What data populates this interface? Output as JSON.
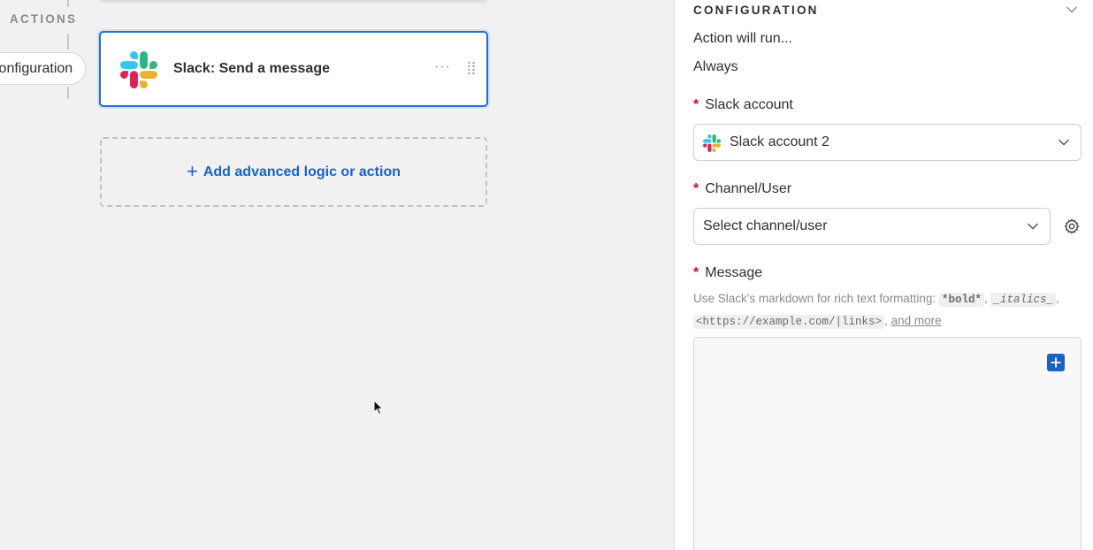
{
  "canvas": {
    "section_label": "ACTIONS",
    "config_pill_label": "Configuration",
    "action_card": {
      "title": "Slack: Send a message",
      "menu_glyph": "···"
    },
    "add_action_label": "Add advanced logic or action"
  },
  "panel": {
    "section_title": "CONFIGURATION",
    "run_label": "Action will run...",
    "run_value": "Always",
    "slack_account": {
      "label": "Slack account",
      "value": "Slack account 2"
    },
    "channel": {
      "label": "Channel/User",
      "value": "Select channel/user"
    },
    "message": {
      "label": "Message",
      "help_prefix": "Use Slack's markdown for rich text formatting:",
      "code_bold": "*bold*",
      "code_italic": "_italics_",
      "code_link": "<https://example.com/|links>",
      "more_link": "and more"
    },
    "required_mark": "*"
  },
  "colors": {
    "accent": "#1f6fd9",
    "link_blue": "#1a63c4",
    "required": "#c8102e",
    "slack_red": "#e01e5a",
    "slack_blue": "#36c5f0",
    "slack_green": "#2eb67d",
    "slack_yellow": "#ecb22e"
  }
}
